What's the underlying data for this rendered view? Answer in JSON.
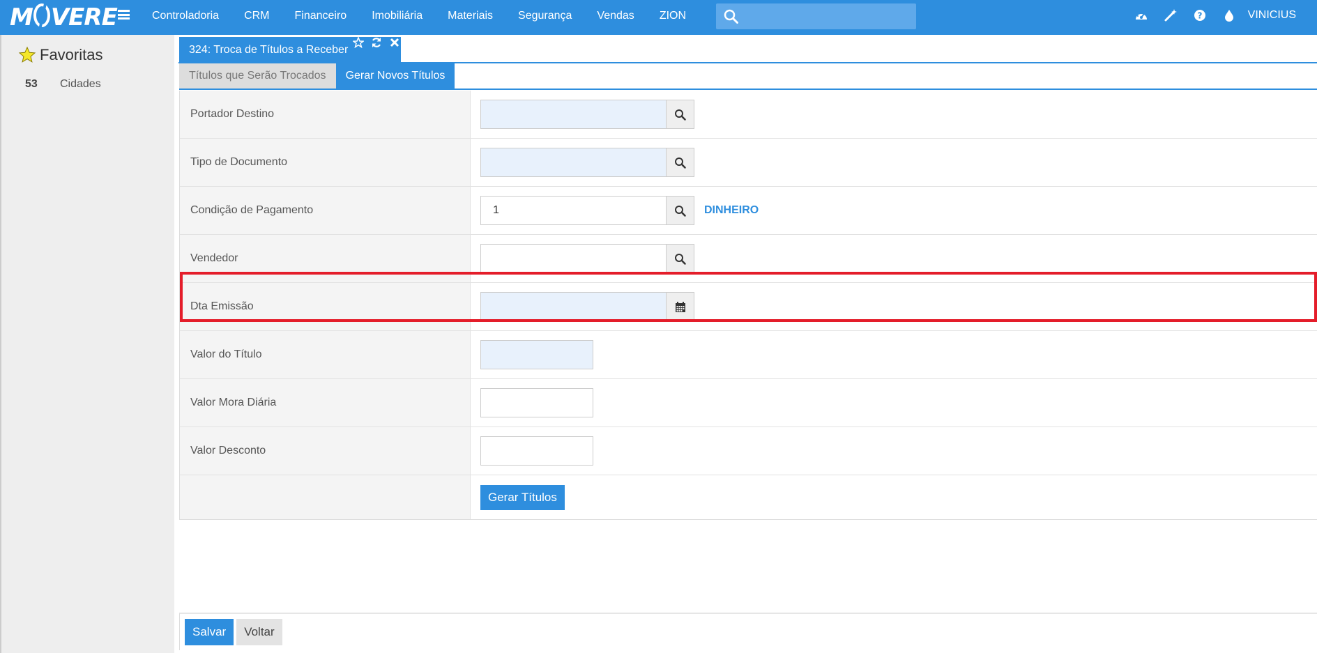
{
  "app": {
    "logo": "MOVERE",
    "nav": [
      "Controladoria",
      "CRM",
      "Financeiro",
      "Imobiliária",
      "Materiais",
      "Segurança",
      "Vendas",
      "ZION"
    ],
    "search_placeholder": "",
    "user": "VINICIUS",
    "top_icons": [
      "dashboard-icon",
      "magic-wand-icon",
      "help-icon",
      "drop-icon"
    ]
  },
  "sidebar": {
    "title": "Favoritas",
    "items": [
      {
        "num": "53",
        "label": "Cidades"
      }
    ]
  },
  "window": {
    "title": "324: Troca de Títulos a Receber",
    "tabs": [
      "Títulos que Serão Trocados",
      "Gerar Novos Títulos"
    ],
    "active_tab": "Gerar Novos Títulos"
  },
  "form": {
    "portador_destino": {
      "label": "Portador Destino",
      "value": ""
    },
    "tipo_documento": {
      "label": "Tipo de Documento",
      "value": ""
    },
    "condicao_pagamento": {
      "label": "Condição de Pagamento",
      "value": "1",
      "description": "DINHEIRO"
    },
    "vendedor": {
      "label": "Vendedor",
      "value": ""
    },
    "dta_emissao": {
      "label": "Dta Emissão",
      "value": ""
    },
    "valor_titulo": {
      "label": "Valor do Título",
      "value": ""
    },
    "valor_mora": {
      "label": "Valor Mora Diária",
      "value": ""
    },
    "valor_desconto": {
      "label": "Valor Desconto",
      "value": ""
    },
    "gerar_button": "Gerar Títulos"
  },
  "footer": {
    "save": "Salvar",
    "back": "Voltar"
  },
  "colors": {
    "primary": "#2e8ede",
    "highlight": "#e41d2a",
    "input_readonly": "#e8f1fc"
  }
}
